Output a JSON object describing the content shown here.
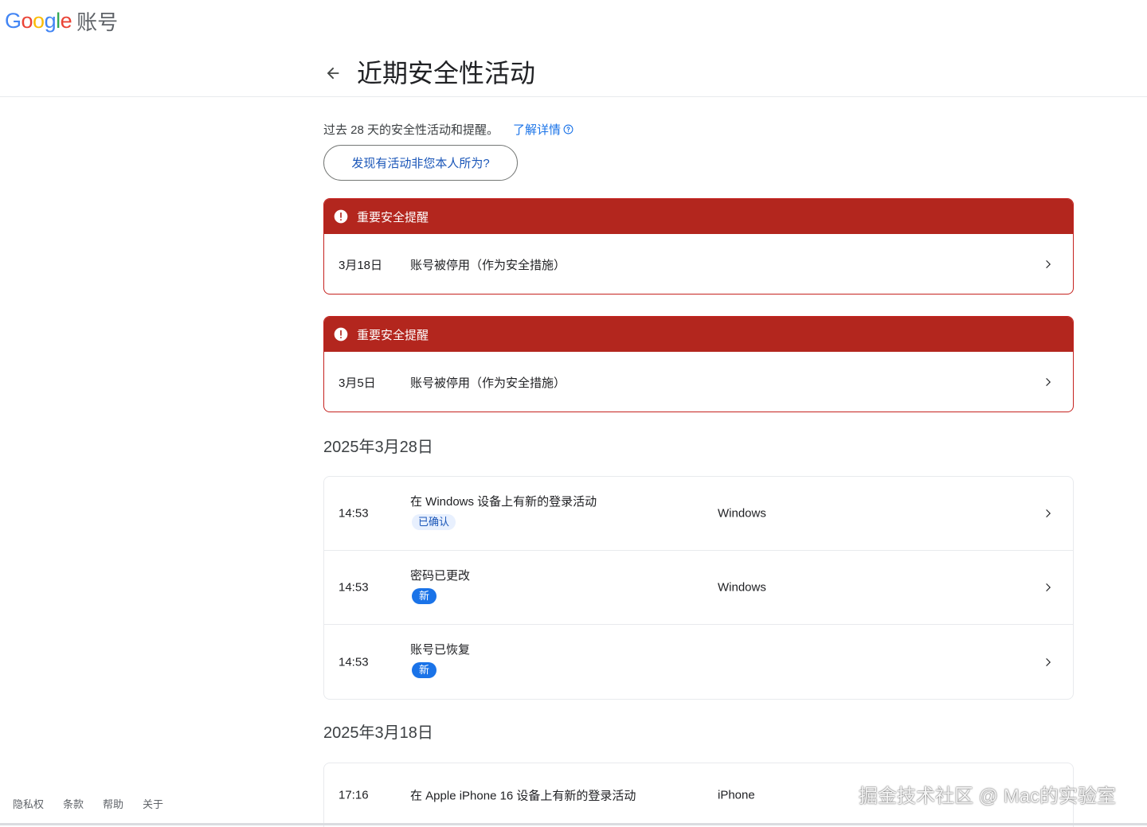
{
  "header": {
    "logo_letters": [
      {
        "ch": "G",
        "color": "#4285F4"
      },
      {
        "ch": "o",
        "color": "#EA4335"
      },
      {
        "ch": "o",
        "color": "#FBBC05"
      },
      {
        "ch": "g",
        "color": "#4285F4"
      },
      {
        "ch": "l",
        "color": "#34A853"
      },
      {
        "ch": "e",
        "color": "#EA4335"
      }
    ],
    "product": "账号",
    "page_title": "近期安全性活动"
  },
  "intro": {
    "text": "过去 28 天的安全性活动和提醒。",
    "learn_more": "了解详情"
  },
  "report_button": "发现有活动非您本人所为?",
  "alerts": [
    {
      "header": "重要安全提醒",
      "date": "3月18日",
      "description": "账号被停用（作为安全措施）"
    },
    {
      "header": "重要安全提醒",
      "date": "3月5日",
      "description": "账号被停用（作为安全措施）"
    }
  ],
  "groups": [
    {
      "date": "2025年3月28日",
      "items": [
        {
          "time": "14:53",
          "title": "在 Windows 设备上有新的登录活动",
          "badge": "已确认",
          "badge_type": "confirmed",
          "device": "Windows"
        },
        {
          "time": "14:53",
          "title": "密码已更改",
          "badge": "新",
          "badge_type": "new",
          "device": "Windows"
        },
        {
          "time": "14:53",
          "title": "账号已恢复",
          "badge": "新",
          "badge_type": "new",
          "device": ""
        }
      ]
    },
    {
      "date": "2025年3月18日",
      "items": [
        {
          "time": "17:16",
          "title": "在 Apple iPhone 16 设备上有新的登录活动",
          "badge": "",
          "badge_type": "",
          "device": "iPhone"
        }
      ]
    }
  ],
  "footer": {
    "privacy": "隐私权",
    "terms": "条款",
    "help": "帮助",
    "about": "关于"
  },
  "watermark": "掘金技术社区 @ Mac的实验室",
  "colors": {
    "alert_red": "#b3261e",
    "link_blue": "#1a73e8",
    "badge_confirm_bg": "#e8f0fe"
  }
}
